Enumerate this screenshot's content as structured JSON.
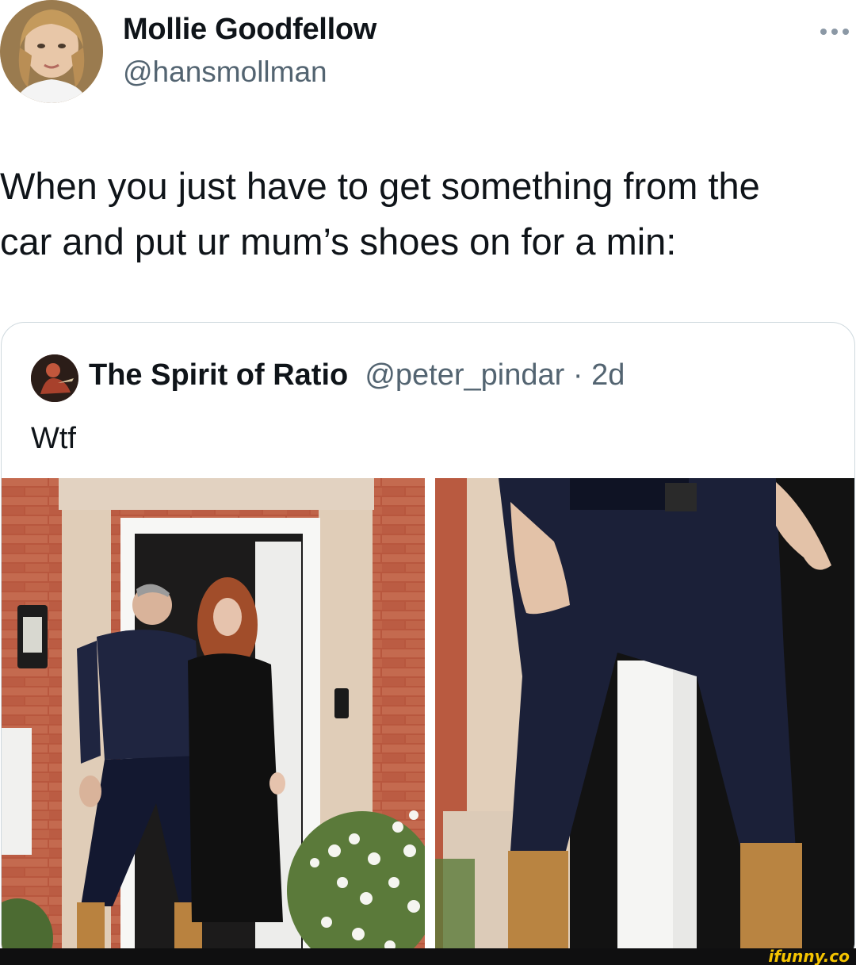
{
  "author": {
    "display_name": "Mollie Goodfellow",
    "handle": "@hansmollman",
    "avatar_icon": "profile-photo"
  },
  "more_icon": "more-horizontal-icon",
  "tweet": {
    "text_line1": "When you just have to get something from the",
    "text_line2": "car and put ur mum’s shoes on for a min:"
  },
  "quoted": {
    "display_name": "The Spirit of Ratio",
    "handle": "@peter_pindar",
    "separator": " · ",
    "time": "2d",
    "text": "Wtf"
  },
  "watermark": "ifunny.co",
  "colors": {
    "text": "#0f1419",
    "secondary": "#536471",
    "border": "#cfd9de",
    "watermark": "#f5c400"
  }
}
